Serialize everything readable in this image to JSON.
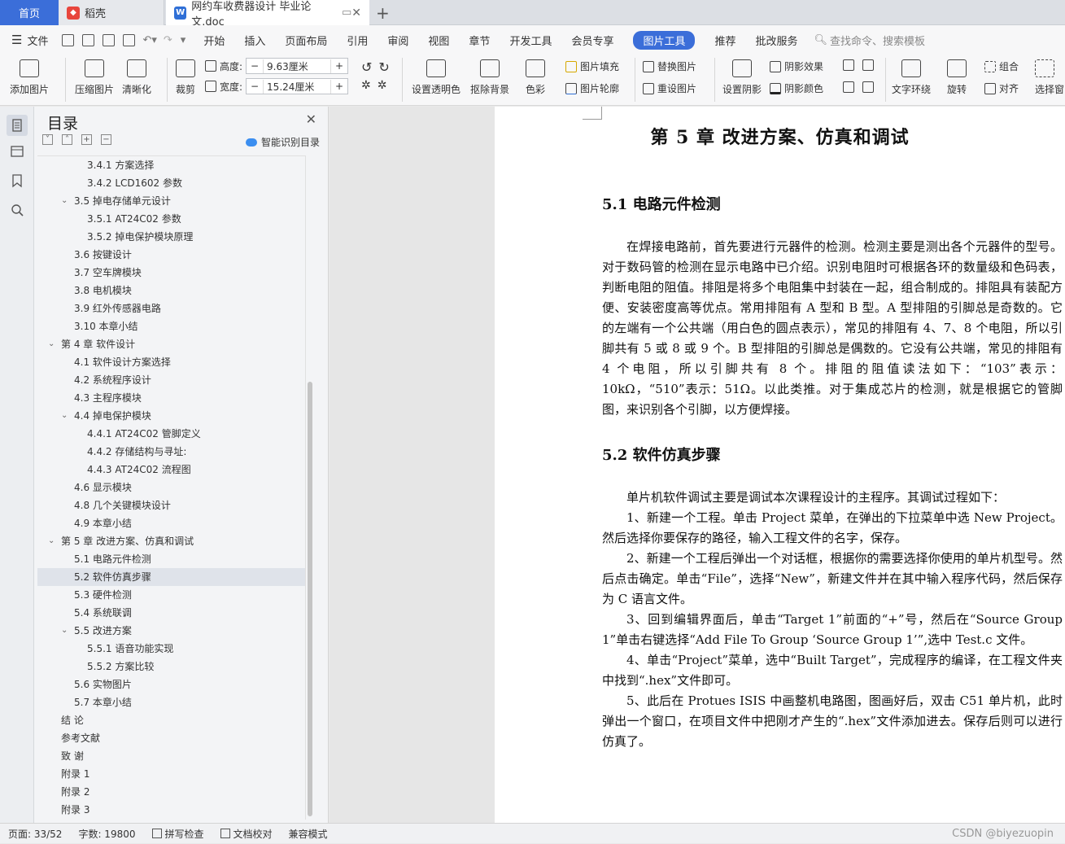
{
  "tabs": {
    "home": "首页",
    "daoke": "稻壳",
    "doc": "网约车收费器设计 毕业论文.doc"
  },
  "menu": {
    "file": "文件",
    "items": [
      "开始",
      "插入",
      "页面布局",
      "引用",
      "审阅",
      "视图",
      "章节",
      "开发工具",
      "会员专享",
      "图片工具",
      "推荐",
      "批改服务"
    ],
    "search": "查找命令、搜索模板"
  },
  "ribbon": {
    "add_image": "添加图片",
    "compress": "压缩图片",
    "sharpen": "清晰化",
    "crop": "裁剪",
    "height_label": "高度:",
    "height_value": "9.63厘米",
    "width_label": "宽度:",
    "width_value": "15.24厘米",
    "transparent": "设置透明色",
    "remove_bg": "抠除背景",
    "color": "色彩",
    "fill": "图片填充",
    "outline": "图片轮廓",
    "replace": "替换图片",
    "reset": "重设图片",
    "set_shadow": "设置阴影",
    "shadow_effect": "阴影效果",
    "shadow_color": "阴影颜色",
    "wrap": "文字环绕",
    "rotate": "旋转",
    "group": "组合",
    "align": "对齐",
    "select": "选择窗"
  },
  "toc": {
    "title": "目录",
    "smart": "智能识别目录",
    "items": [
      {
        "text": "3.4.1  方案选择",
        "level": 3,
        "chev": ""
      },
      {
        "text": "3.4.2 LCD1602 参数",
        "level": 3,
        "chev": ""
      },
      {
        "text": "3.5  掉电存储单元设计",
        "level": 2,
        "chev": "v"
      },
      {
        "text": "3.5.1 AT24C02 参数",
        "level": 3,
        "chev": ""
      },
      {
        "text": "3.5.2  掉电保护模块原理",
        "level": 3,
        "chev": ""
      },
      {
        "text": "3.6  按键设计",
        "level": 2,
        "chev": ""
      },
      {
        "text": "3.7  空车牌模块",
        "level": 2,
        "chev": ""
      },
      {
        "text": "3.8  电机模块",
        "level": 2,
        "chev": ""
      },
      {
        "text": "3.9  红外传感器电路",
        "level": 2,
        "chev": ""
      },
      {
        "text": "3.10  本章小结",
        "level": 2,
        "chev": ""
      },
      {
        "text": "第 4 章  软件设计",
        "level": 1,
        "chev": "v"
      },
      {
        "text": "4.1  软件设计方案选择",
        "level": 2,
        "chev": ""
      },
      {
        "text": "4.2  系统程序设计",
        "level": 2,
        "chev": ""
      },
      {
        "text": "4.3  主程序模块",
        "level": 2,
        "chev": ""
      },
      {
        "text": "4.4  掉电保护模块",
        "level": 2,
        "chev": "v"
      },
      {
        "text": "4.4.1 AT24C02 管脚定义",
        "level": 3,
        "chev": ""
      },
      {
        "text": "4.4.2  存储结构与寻址:",
        "level": 3,
        "chev": ""
      },
      {
        "text": "4.4.3 AT24C02 流程图",
        "level": 3,
        "chev": ""
      },
      {
        "text": "4.6  显示模块",
        "level": 2,
        "chev": ""
      },
      {
        "text": "4.8  几个关键模块设计",
        "level": 2,
        "chev": ""
      },
      {
        "text": "4.9 本章小结",
        "level": 2,
        "chev": ""
      },
      {
        "text": "第 5 章  改进方案、仿真和调试",
        "level": 1,
        "chev": "v"
      },
      {
        "text": "5.1  电路元件检测",
        "level": 2,
        "chev": ""
      },
      {
        "text": "5.2  软件仿真步骤",
        "level": 2,
        "chev": "",
        "selected": true
      },
      {
        "text": "5.3  硬件检测",
        "level": 2,
        "chev": ""
      },
      {
        "text": "5.4  系统联调",
        "level": 2,
        "chev": ""
      },
      {
        "text": "5.5  改进方案",
        "level": 2,
        "chev": "v"
      },
      {
        "text": "5.5.1  语音功能实现",
        "level": 3,
        "chev": ""
      },
      {
        "text": "5.5.2  方案比较",
        "level": 3,
        "chev": ""
      },
      {
        "text": "5.6  实物图片",
        "level": 2,
        "chev": ""
      },
      {
        "text": "5.7 本章小结",
        "level": 2,
        "chev": ""
      },
      {
        "text": "结  论",
        "level": 1,
        "chev": ""
      },
      {
        "text": "参考文献",
        "level": 1,
        "chev": ""
      },
      {
        "text": "致  谢",
        "level": 1,
        "chev": ""
      },
      {
        "text": "附录 1",
        "level": 1,
        "chev": ""
      },
      {
        "text": "附录 2",
        "level": 1,
        "chev": ""
      },
      {
        "text": "附录 3",
        "level": 1,
        "chev": ""
      }
    ]
  },
  "document": {
    "chapter_title": "第 5 章  改进方案、仿真和调试",
    "section1_title": "5.1  电路元件检测",
    "section1_para": "在焊接电路前，首先要进行元器件的检测。检测主要是测出各个元器件的型号。对于数码管的检测在显示电路中已介绍。识别电阻时可根据各环的数量级和色码表，判断电阻的阻值。排阻是将多个电阻集中封装在一起，组合制成的。排阻具有装配方便、安装密度高等优点。常用排阻有 A 型和 B 型。A 型排阻的引脚总是奇数的。它的左端有一个公共端（用白色的圆点表示），常见的排阻有 4、7、8 个电阻，所以引脚共有 5 或 8 或 9 个。B 型排阻的引脚总是偶数的。它没有公共端，常见的排阻有 4 个电阻，所以引脚共有 8 个。排阻的阻值读法如下：“103”表示：10kΩ，“510”表示：51Ω。以此类推。对于集成芯片的检测，就是根据它的管脚图，来识别各个引脚，以方便焊接。",
    "section2_title": "5.2  软件仿真步骤",
    "section2_paras": [
      "单片机软件调试主要是调试本次课程设计的主程序。其调试过程如下：",
      "1、新建一个工程。单击 Project 菜单，在弹出的下拉菜单中选 New Project。然后选择你要保存的路径，输入工程文件的名字，保存。",
      "2、新建一个工程后弹出一个对话框，根据你的需要选择你使用的单片机型号。然后点击确定。单击“File”，选择“New”，新建文件并在其中输入程序代码，然后保存为 C 语言文件。",
      "3、回到编辑界面后，单击“Target 1”前面的“+”号，然后在“Source Group 1”单击右键选择“Add File To Group ‘Source Group 1’”,选中 Test.c 文件。",
      "4、单击“Project”菜单，选中“Built Target”，完成程序的编译，在工程文件夹中找到“.hex”文件即可。",
      "5、此后在 Protues ISIS 中画整机电路图，图画好后，双击 C51 单片机，此时弹出一个窗口，在项目文件中把刚才产生的“.hex”文件添加进去。保存后则可以进行仿真了。"
    ]
  },
  "status": {
    "page": "页面: 33/52",
    "words": "字数: 19800",
    "spell": "拼写检查",
    "proof": "文档校对",
    "compat": "兼容模式",
    "watermark": "CSDN @biyezuopin"
  },
  "colors": {
    "accent": "#3b6ed9",
    "wps_red": "#e8453c",
    "wps_blue": "#2f6fd6"
  }
}
